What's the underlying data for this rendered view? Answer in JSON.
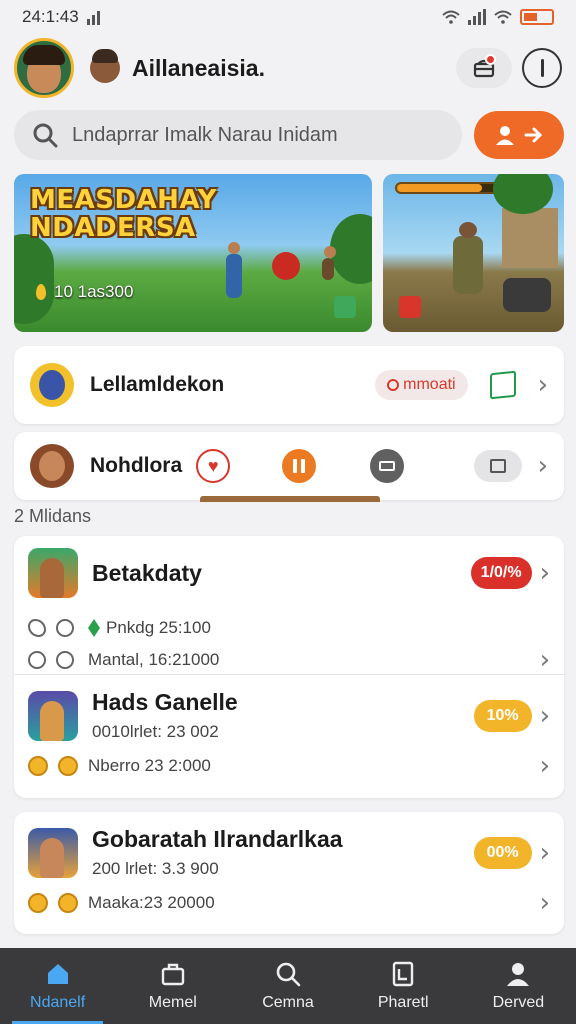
{
  "status_bar": {
    "time": "24:1:43"
  },
  "header": {
    "user_name": "Aillaneaisia."
  },
  "search": {
    "placeholder": "Lndaprrar Imalk Narau Inidam"
  },
  "banner": {
    "title_line1": "MEASDAHAY",
    "title_line2": "NDADERSA",
    "score": "10 1as300"
  },
  "rows": [
    {
      "title": "Lellamldekon",
      "pill": "mmoati"
    },
    {
      "title": "Nohdlora"
    }
  ],
  "section_label": "2 Mlidans",
  "games": [
    {
      "title": "Betakdaty",
      "badge": "1/0/%",
      "badge_color": "#d9302a",
      "meta1": "Pnkdg 25:100",
      "meta2": "Mantal, 16:21000"
    },
    {
      "title": "Hads Ganelle",
      "badge": "10%",
      "badge_color": "#f2b52a",
      "meta1": "0010lrlet: 23 002",
      "meta2": "Nberro 23 2:000"
    },
    {
      "title": "Gobaratah Ilrandarlkaa",
      "badge": "00%",
      "badge_color": "#f2b52a",
      "meta1": "200 lrlet: 3.3 900",
      "meta2": "Maaka:23 20000"
    }
  ],
  "nav": [
    {
      "label": "Ndanelf",
      "icon": "home-icon"
    },
    {
      "label": "Memel",
      "icon": "briefcase-icon"
    },
    {
      "label": "Cemna",
      "icon": "search-icon"
    },
    {
      "label": "Pharetl",
      "icon": "document-icon"
    },
    {
      "label": "Derved",
      "icon": "profile-icon"
    }
  ],
  "colors": {
    "accent": "#ef6a26",
    "nav_active": "#4aa8f2",
    "nav_bg": "#3a3a3c"
  }
}
